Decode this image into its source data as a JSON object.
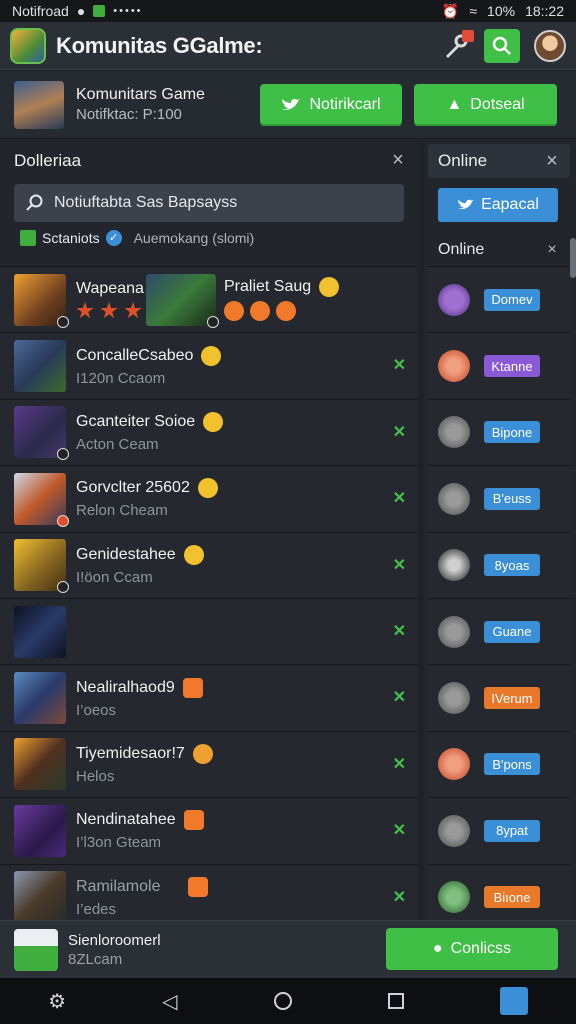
{
  "status_bar": {
    "carrier": "Notifroad",
    "battery": "10%",
    "time": "18::22"
  },
  "app_bar": {
    "title": "Komunitas GGalme:"
  },
  "profile": {
    "name": "Komunitars Game",
    "subtitle": "Notifktac: P:100",
    "btn_notify": "Notirikcarl",
    "btn_download": "Dotseal"
  },
  "left_panel": {
    "title": "Dolleriaa",
    "search_placeholder": "Notiuftabta Sas Bapsayss",
    "tag_label": "Sctaniots",
    "tag_status": "Auemokang (slomi)",
    "rows": [
      {
        "title": "Wapeana",
        "title2": "Praliet Saug",
        "subtitle": ""
      },
      {
        "title": "ConcalleCsabeo",
        "subtitle": "I120n Ccaom"
      },
      {
        "title": "Gcanteiter Soioe",
        "subtitle": "Acton Ceam"
      },
      {
        "title": "Gorvclter 25602",
        "subtitle": "Relon Cheam"
      },
      {
        "title": "Genidestahee",
        "subtitle": "I!öon Ccam"
      },
      {
        "title": "",
        "subtitle": ""
      },
      {
        "title": "Nealiralhaod9",
        "subtitle": "I’oeos"
      },
      {
        "title": "Tiyemidesaor!7",
        "subtitle": "Helos"
      },
      {
        "title": "Nendinatahee",
        "subtitle": "I’l3on Gteam"
      },
      {
        "title": "Ramilamole",
        "subtitle": "I’edes"
      }
    ]
  },
  "right_panel": {
    "title": "Online",
    "action_btn": "Eapacal",
    "subtitle": "Online",
    "users": [
      {
        "label": "Domev",
        "color": "#3b8fd6"
      },
      {
        "label": "Ktanne",
        "color": "#8a5ad6"
      },
      {
        "label": "Bipone",
        "color": "#3b8fd6"
      },
      {
        "label": "B'euss",
        "color": "#3b8fd6"
      },
      {
        "label": "8yoas",
        "color": "#3b8fd6"
      },
      {
        "label": "Guane",
        "color": "#3b8fd6"
      },
      {
        "label": "IVerum",
        "color": "#e8782a"
      },
      {
        "label": "B'pons",
        "color": "#3b8fd6"
      },
      {
        "label": "8ypat",
        "color": "#3b8fd6"
      },
      {
        "label": "Biıone",
        "color": "#e8782a"
      }
    ]
  },
  "bottom_bar": {
    "line1": "Sienloroomerl",
    "line2": "8ZLcam",
    "connect_label": "Conlicss"
  }
}
